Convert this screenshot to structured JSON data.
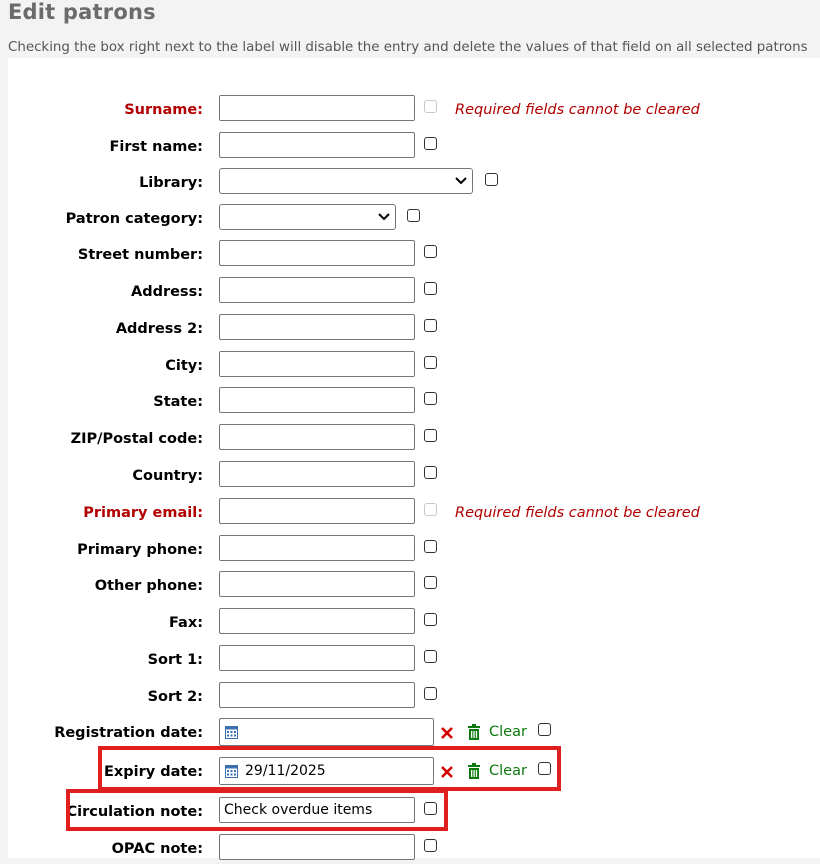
{
  "page": {
    "title": "Edit patrons",
    "description": "Checking the box right next to the label will disable the entry and delete the values of that field on all selected patrons"
  },
  "required_note": "Required fields cannot be cleared",
  "colors": {
    "required": "#b20000",
    "clear_link": "#0d7a0d",
    "highlight": "#e02020",
    "clear_x": "#d40000"
  },
  "fields": {
    "surname": {
      "label": "Surname:",
      "value": ""
    },
    "first_name": {
      "label": "First name:",
      "value": ""
    },
    "library": {
      "label": "Library:",
      "value": ""
    },
    "patron_category": {
      "label": "Patron category:",
      "value": ""
    },
    "street_number": {
      "label": "Street number:",
      "value": ""
    },
    "address": {
      "label": "Address:",
      "value": ""
    },
    "address2": {
      "label": "Address 2:",
      "value": ""
    },
    "city": {
      "label": "City:",
      "value": ""
    },
    "state": {
      "label": "State:",
      "value": ""
    },
    "zip": {
      "label": "ZIP/Postal code:",
      "value": ""
    },
    "country": {
      "label": "Country:",
      "value": ""
    },
    "primary_email": {
      "label": "Primary email:",
      "value": ""
    },
    "primary_phone": {
      "label": "Primary phone:",
      "value": ""
    },
    "other_phone": {
      "label": "Other phone:",
      "value": ""
    },
    "fax": {
      "label": "Fax:",
      "value": ""
    },
    "sort1": {
      "label": "Sort 1:",
      "value": ""
    },
    "sort2": {
      "label": "Sort 2:",
      "value": ""
    },
    "registration_date": {
      "label": "Registration date:",
      "value": "",
      "clear_label": "Clear"
    },
    "expiry_date": {
      "label": "Expiry date:",
      "value": "29/11/2025",
      "clear_label": "Clear"
    },
    "circulation_note": {
      "label": "Circulation note:",
      "value": "Check overdue items"
    },
    "opac_note": {
      "label": "OPAC note:",
      "value": ""
    }
  },
  "icons": {
    "calendar": "calendar-icon",
    "clear_x": "close-icon",
    "trash": "trash-icon",
    "dropdown": "chevron-down-icon"
  }
}
